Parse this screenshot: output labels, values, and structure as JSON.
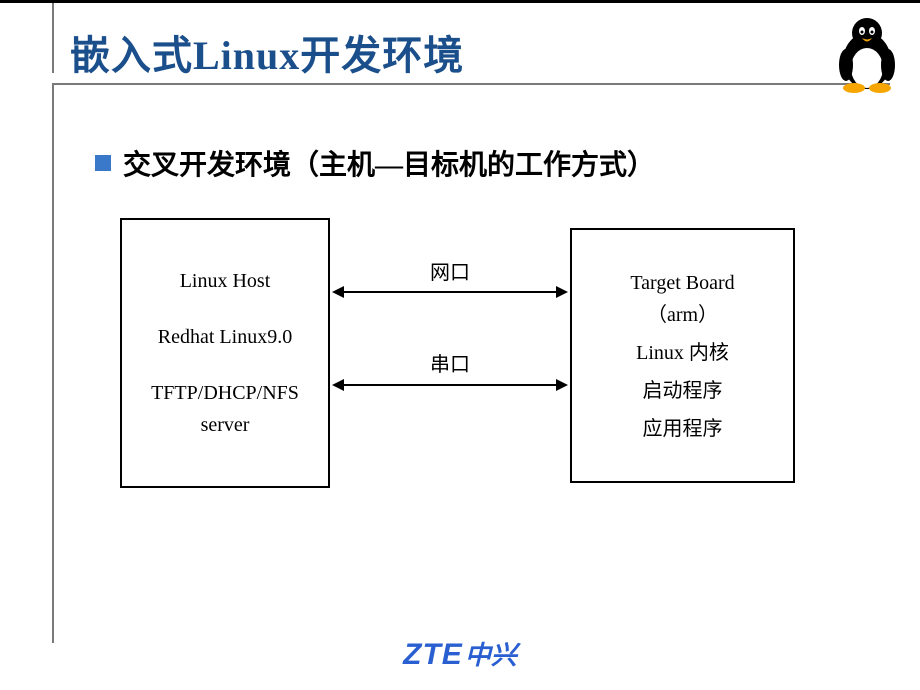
{
  "title": "嵌入式Linux开发环境",
  "bullet": "交叉开发环境（主机—目标机的工作方式）",
  "diagram": {
    "left_box": {
      "line1": "Linux Host",
      "line2": "Redhat Linux9.0",
      "line3": "TFTP/DHCP/NFS server"
    },
    "right_box": {
      "line1": "Target Board",
      "line2": "（arm）",
      "line3": "Linux 内核",
      "line4": "启动程序",
      "line5": "应用程序"
    },
    "conn_top": "网口",
    "conn_bottom": "串口"
  },
  "footer": {
    "brand_en": "ZTE",
    "brand_cn": "中兴"
  },
  "mascot": "tux-penguin"
}
